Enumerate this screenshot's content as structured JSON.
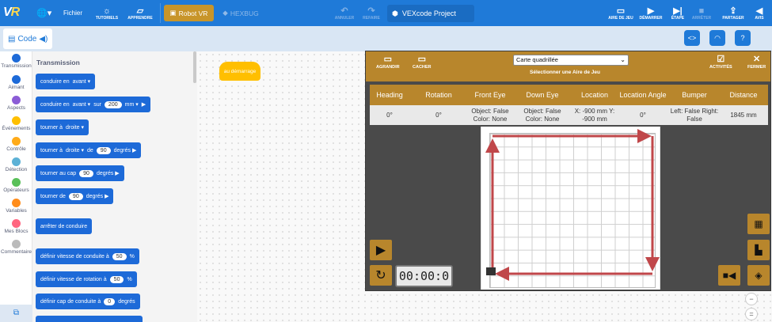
{
  "topbar": {
    "logo_a": "V",
    "logo_b": "R",
    "menu_file": "Fichier",
    "tutorials": "TUTORIELS",
    "learn": "APPRENDRE",
    "robot_tab": "Robot VR",
    "hexbug_tab": "HEXBUG",
    "undo": "ANNULER",
    "redo": "REFAIRE",
    "project_name": "VEXcode Project",
    "playground": "AIRE DE JEU",
    "start": "DÉMARRER",
    "step": "ÉTAPE",
    "stop": "ARRÊTER",
    "share": "PARTAGER",
    "feedback": "AVIS"
  },
  "codebar": {
    "code_label": "Code"
  },
  "categories": [
    {
      "label": "Transmission",
      "color": "#1d6ad8"
    },
    {
      "label": "Aimant",
      "color": "#1d6ad8"
    },
    {
      "label": "Aspects",
      "color": "#8b5cd6"
    },
    {
      "label": "Événements",
      "color": "#ffbf00"
    },
    {
      "label": "Contrôle",
      "color": "#ffab19"
    },
    {
      "label": "Détection",
      "color": "#5cb1d6"
    },
    {
      "label": "Opérateurs",
      "color": "#59c059"
    },
    {
      "label": "Variables",
      "color": "#ff8c1a"
    },
    {
      "label": "Mes Blocs",
      "color": "#ff6680"
    },
    {
      "label": "Commentaire",
      "color": "#bbbbbb"
    }
  ],
  "palette": {
    "title": "Transmission",
    "blocks": {
      "b1": {
        "t1": "conduire en",
        "d1": "avant ▾"
      },
      "b2": {
        "t1": "conduire en",
        "d1": "avant ▾",
        "t2": "sur",
        "v1": "200",
        "d2": "mm ▾",
        "tail": "▶"
      },
      "b3": {
        "t1": "tourner à",
        "d1": "droite ▾"
      },
      "b4": {
        "t1": "tourner à",
        "d1": "droite ▾",
        "t2": "de",
        "v1": "90",
        "t3": "degrés ▶"
      },
      "b5": {
        "t1": "tourner au cap",
        "v1": "90",
        "t2": "degrés ▶"
      },
      "b6": {
        "t1": "tourner de",
        "v1": "90",
        "t2": "degrés ▶"
      },
      "b7": {
        "t1": "arrêter de conduire"
      },
      "b8": {
        "t1": "définir vitesse de conduite à",
        "v1": "50",
        "t2": "%"
      },
      "b9": {
        "t1": "définir vitesse de rotation à",
        "v1": "50",
        "t2": "%"
      },
      "b10": {
        "t1": "définir cap de conduite à",
        "v1": "0",
        "t2": "degrés"
      }
    }
  },
  "workspace": {
    "hat_block": "au démarrage"
  },
  "sim": {
    "expand": "AGRANDIR",
    "hide": "CACHER",
    "playground_select": "Carte quadrillée",
    "select_label": "Sélectionner une Aire de Jeu",
    "activities": "ACTIVITÉS",
    "close": "FERMER",
    "timer": "00:00:0",
    "table": {
      "headers": [
        "Heading",
        "Rotation",
        "Front Eye",
        "Down Eye",
        "Location",
        "Location Angle",
        "Bumper",
        "Distance"
      ],
      "values": [
        "0°",
        "0°",
        "Object: False Color: None",
        "Object: False Color: None",
        "X: -900 mm Y: -900 mm",
        "0°",
        "Left: False Right: False",
        "1845 mm"
      ]
    }
  },
  "colors": {
    "accent": "#1f7ad8",
    "sim_gold": "#b8862c",
    "path_red": "#c0474a"
  }
}
